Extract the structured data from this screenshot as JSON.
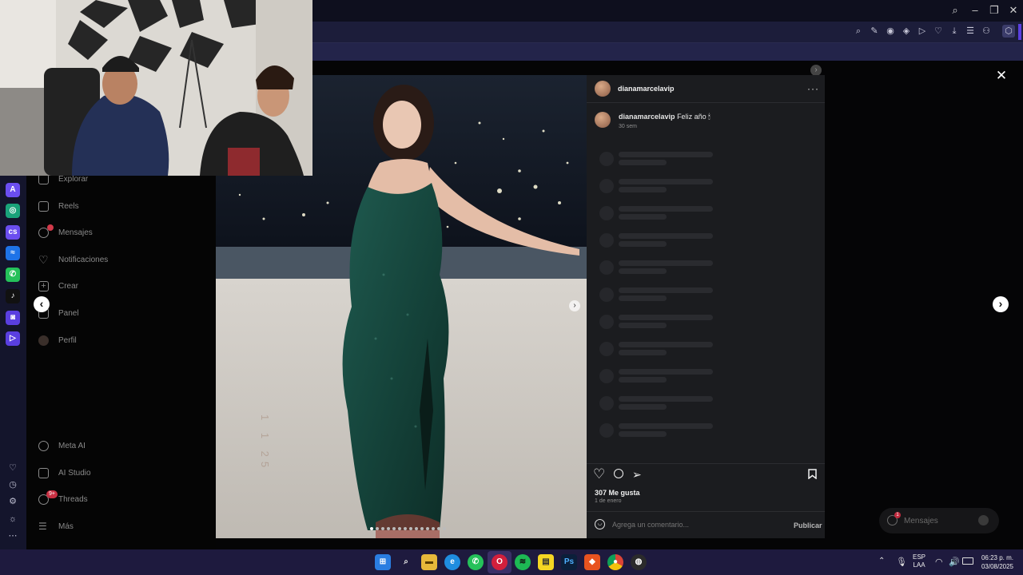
{
  "browser": {
    "window_controls": [
      "search-icon",
      "minimize-icon",
      "restore-icon",
      "close-icon"
    ],
    "toolbar_icons": [
      "search-icon",
      "edit-icon",
      "camera-icon",
      "shield-icon",
      "play-icon",
      "heart-icon",
      "download-icon",
      "menu-icon",
      "profile-icon",
      "cube-icon"
    ],
    "accent": "#5a3fe0"
  },
  "sidepanel": {
    "apps": [
      "aria-icon",
      "chatgpt-icon",
      "cs-icon",
      "messenger-icon",
      "whatsapp-icon",
      "tiktok-icon",
      "instagram-icon",
      "player-icon"
    ],
    "bottom": [
      "heart-icon",
      "history-icon",
      "settings-icon",
      "lightbulb-icon",
      "more-icon"
    ]
  },
  "nav": {
    "items": [
      {
        "label": "Explorar"
      },
      {
        "label": "Reels"
      },
      {
        "label": "Mensajes"
      },
      {
        "label": "Notificaciones"
      },
      {
        "label": "Crear"
      },
      {
        "label": "Panel"
      },
      {
        "label": "Perfil"
      },
      {
        "label": "Meta AI"
      },
      {
        "label": "AI Studio"
      },
      {
        "label": "Threads"
      },
      {
        "label": "Más"
      }
    ],
    "threads_badge": "9+"
  },
  "post": {
    "username": "dianamarcelavip",
    "caption_user": "dianamarcelavip",
    "caption_text": "Feliz año 🕯",
    "caption_time": "30 sem",
    "likes": "307 Me gusta",
    "date": "1 de enero",
    "comment_placeholder": "Agrega un comentario...",
    "publish": "Publicar",
    "photo_watermark": "1 1 25"
  },
  "messages_pill": {
    "label": "Mensajes",
    "badge": "1"
  },
  "taskbar": {
    "apps": [
      "windows-icon",
      "search-icon",
      "file-explorer-icon",
      "edge-icon",
      "whatsapp-icon",
      "opera-gx-icon",
      "spotify-icon",
      "sticky-notes-icon",
      "photoshop-icon",
      "brave-icon",
      "chrome-icon",
      "obs-icon"
    ],
    "language_top": "ESP",
    "language_bottom": "LAA",
    "time": "06:23 p. m.",
    "date": "03/08/2025"
  }
}
